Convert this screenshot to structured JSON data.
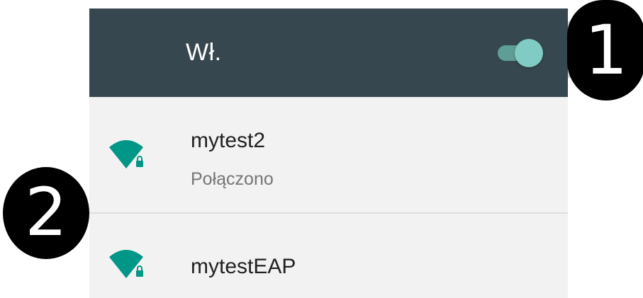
{
  "header": {
    "label": "Wł.",
    "toggle_state": "on"
  },
  "networks": [
    {
      "ssid": "mytest2",
      "status": "Połączono",
      "secured": true,
      "icon": "wifi-signal-full-lock-icon"
    },
    {
      "ssid": "mytestEAP",
      "secured": true,
      "icon": "wifi-signal-full-lock-icon"
    }
  ],
  "annotations": {
    "badge_1": "1",
    "badge_2": "2"
  },
  "colors": {
    "header_bg": "#37474f",
    "accent": "#009688",
    "toggle_thumb": "#80cbc4",
    "toggle_track": "#5f9e96",
    "list_bg": "#f2f2f2"
  }
}
